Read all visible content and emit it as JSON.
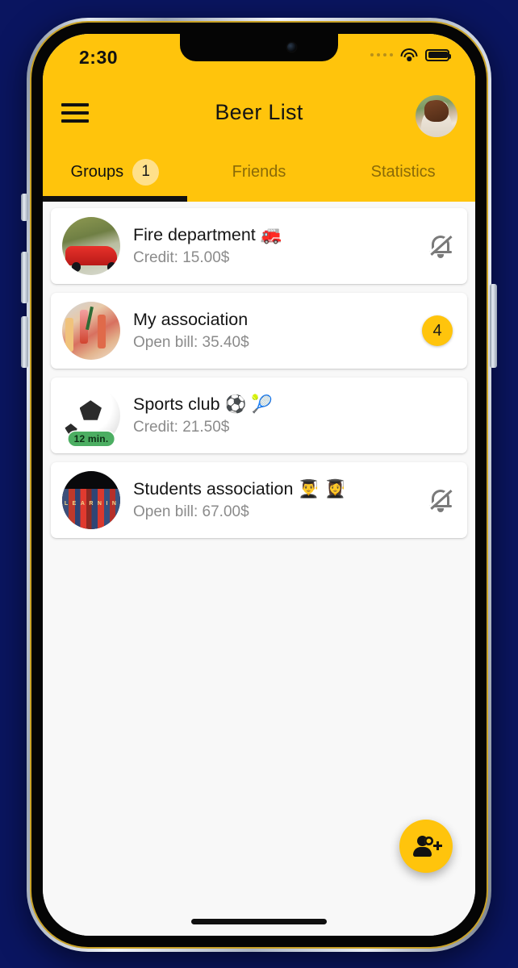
{
  "status_bar": {
    "time": "2:30",
    "signal_icon": "cellular-dots-icon",
    "wifi_icon": "wifi-icon",
    "battery_icon": "battery-full-icon"
  },
  "app_bar": {
    "menu_icon": "hamburger-menu-icon",
    "title": "Beer List",
    "avatar_icon": "user-avatar"
  },
  "tabs": [
    {
      "label": "Groups",
      "badge": "1",
      "active": true
    },
    {
      "label": "Friends",
      "badge": null,
      "active": false
    },
    {
      "label": "Statistics",
      "badge": null,
      "active": false
    }
  ],
  "groups": [
    {
      "title": "Fire department 🚒",
      "subtitle": "Credit: 15.00$",
      "avatar_icon": "fire-truck-avatar",
      "avatar_tag": null,
      "trailing_type": "bell-off-icon",
      "trailing_value": null
    },
    {
      "title": "My association",
      "subtitle": "Open bill: 35.40$",
      "avatar_icon": "cocktails-avatar",
      "avatar_tag": null,
      "trailing_type": "count-badge",
      "trailing_value": "4"
    },
    {
      "title": "Sports club ⚽ 🎾",
      "subtitle": "Credit: 21.50$",
      "avatar_icon": "soccer-ball-avatar",
      "avatar_tag": "12 min.",
      "trailing_type": "none",
      "trailing_value": null
    },
    {
      "title": "Students association 👨‍🎓 👩‍🎓",
      "subtitle": "Open bill: 67.00$",
      "avatar_icon": "books-avatar",
      "avatar_tag": null,
      "trailing_type": "bell-off-icon",
      "trailing_value": null
    }
  ],
  "fab": {
    "icon": "person-add-icon"
  },
  "colors": {
    "brand_yellow": "#ffc40c",
    "badge_light_yellow": "#ffe08a",
    "tag_green": "#4cae62",
    "list_background": "#f8f8f8",
    "page_background": "#0a1560"
  }
}
